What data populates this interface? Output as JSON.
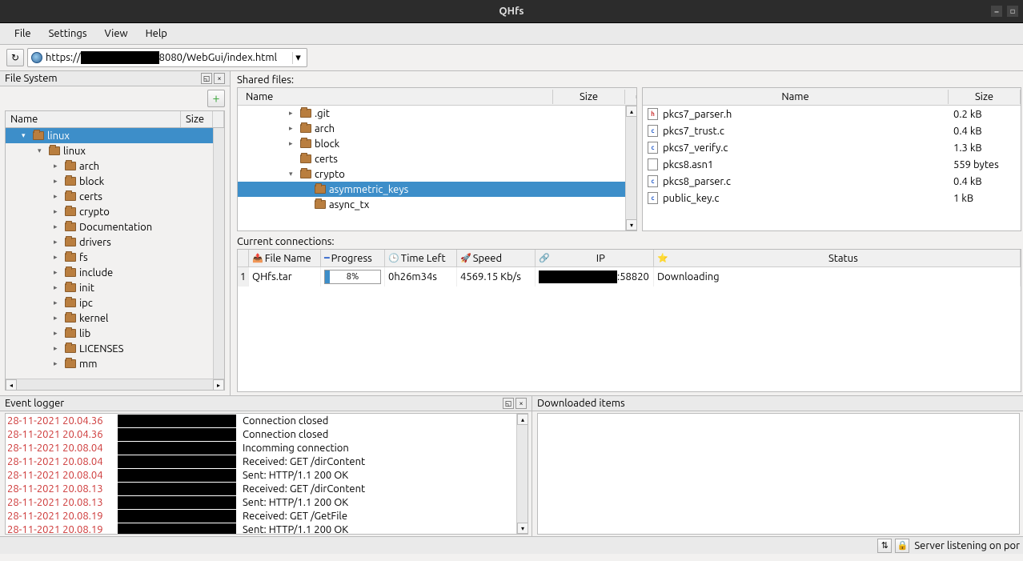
{
  "window_title": "QHfs",
  "menu": {
    "file": "File",
    "settings": "Settings",
    "view": "View",
    "help": "Help"
  },
  "url": {
    "scheme": "https://",
    "suffix": "8080/WebGui/index.html"
  },
  "left": {
    "title": "File System",
    "hdr_name": "Name",
    "hdr_size": "Size",
    "root": "linux",
    "sub": "linux",
    "children": [
      "arch",
      "block",
      "certs",
      "crypto",
      "Documentation",
      "drivers",
      "fs",
      "include",
      "init",
      "ipc",
      "kernel",
      "lib",
      "LICENSES",
      "mm"
    ]
  },
  "shared": {
    "label": "Shared files:",
    "hdr_name": "Name",
    "hdr_size": "Size",
    "tree": [
      {
        "indent": 3,
        "exp": "▸",
        "name": ".git"
      },
      {
        "indent": 3,
        "exp": "▸",
        "name": "arch"
      },
      {
        "indent": 3,
        "exp": "▸",
        "name": "block"
      },
      {
        "indent": 3,
        "exp": "",
        "name": "certs"
      },
      {
        "indent": 3,
        "exp": "▾",
        "name": "crypto"
      },
      {
        "indent": 4,
        "exp": "",
        "name": "asymmetric_keys",
        "sel": true
      },
      {
        "indent": 4,
        "exp": "",
        "name": "async_tx"
      }
    ],
    "files": [
      {
        "icon": "h",
        "name": "pkcs7_parser.h",
        "size": "0.2 kB"
      },
      {
        "icon": "c",
        "name": "pkcs7_trust.c",
        "size": "0.4 kB"
      },
      {
        "icon": "c",
        "name": "pkcs7_verify.c",
        "size": "1.3 kB"
      },
      {
        "icon": "p",
        "name": "pkcs8.asn1",
        "size": "559 bytes"
      },
      {
        "icon": "c",
        "name": "pkcs8_parser.c",
        "size": "0.4 kB"
      },
      {
        "icon": "c",
        "name": "public_key.c",
        "size": "1 kB"
      }
    ]
  },
  "conn": {
    "label": "Current connections:",
    "hdr": {
      "fn": "File Name",
      "pg": "Progress",
      "tl": "Time Left",
      "sp": "Speed",
      "ip": "IP",
      "st": "Status"
    },
    "rows": [
      {
        "idx": "1",
        "fn": "QHfs.tar",
        "pg": "8%",
        "pgv": 8,
        "tl": "0h26m34s",
        "sp": "4569.15 Kb/s",
        "ip_suffix": ":58820",
        "st": "Downloading"
      }
    ]
  },
  "log": {
    "label": "Event logger",
    "dl_label": "Downloaded items",
    "rows": [
      {
        "t": "28-11-2021 20.04.36",
        "m": "Connection closed"
      },
      {
        "t": "28-11-2021 20.04.36",
        "m": "Connection closed"
      },
      {
        "t": "28-11-2021 20.08.04",
        "m": "Incomming connection"
      },
      {
        "t": "28-11-2021 20.08.04",
        "m": "Received: GET /dirContent"
      },
      {
        "t": "28-11-2021 20.08.04",
        "m": "Sent: HTTP/1.1 200 OK"
      },
      {
        "t": "28-11-2021 20.08.13",
        "m": "Received: GET /dirContent"
      },
      {
        "t": "28-11-2021 20.08.13",
        "m": "Sent: HTTP/1.1 200 OK"
      },
      {
        "t": "28-11-2021 20.08.19",
        "m": "Received: GET /GetFile"
      },
      {
        "t": "28-11-2021 20.08.19",
        "m": "Sent: HTTP/1.1 200 OK"
      }
    ]
  },
  "status": "Server listening on por"
}
